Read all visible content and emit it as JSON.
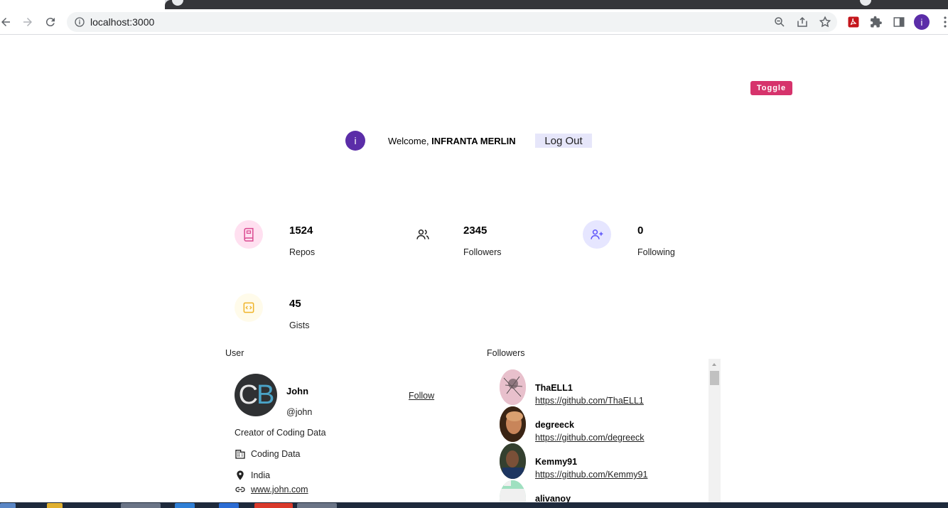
{
  "browser": {
    "url": "localhost:3000",
    "profile_initial": "i"
  },
  "header": {
    "toggle_label": "Toggle",
    "avatar_initial": "i",
    "welcome_prefix": "Welcome, ",
    "user_name": "INFRANTA MERLIN",
    "logout_label": "Log Out"
  },
  "stats": [
    {
      "value": "1524",
      "label": "Repos",
      "icon": "book-icon",
      "bg": "#ffe0f0",
      "fg": "#da4a91"
    },
    {
      "value": "2345",
      "label": "Followers",
      "icon": "users-icon",
      "bg": "#ffffff",
      "fg": "#222222"
    },
    {
      "value": "0",
      "label": "Following",
      "icon": "user-plus-icon",
      "bg": "#e6e6ff",
      "fg": "#5d55fa"
    },
    {
      "value": "45",
      "label": "Gists",
      "icon": "code-icon",
      "bg": "#fffbea",
      "fg": "#f0b429"
    }
  ],
  "user_card": {
    "section_title": "User",
    "avatar_text": "CB",
    "name": "John",
    "handle": "@john",
    "follow_label": "Follow",
    "bio": "Creator of Coding Data",
    "company": "Coding Data",
    "location": "India",
    "blog": "www.john.com"
  },
  "followers_card": {
    "section_title": "Followers",
    "items": [
      {
        "login": "ThaELL1",
        "url": "https://github.com/ThaELL1",
        "avatar_color": "#e8b8c8"
      },
      {
        "login": "degreeck",
        "url": "https://github.com/degreeck",
        "avatar_color": "#5a3a22"
      },
      {
        "login": "Kemmy91",
        "url": "https://github.com/Kemmy91",
        "avatar_color": "#2b3a2a"
      },
      {
        "login": "alivanoy",
        "url": "",
        "avatar_color": "#9fe0c0"
      }
    ]
  }
}
